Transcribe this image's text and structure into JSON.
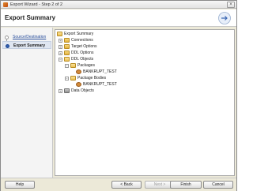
{
  "window": {
    "title": "Export Wizard - Step 2 of 2",
    "close_glyph": "×"
  },
  "header": {
    "title": "Export Summary"
  },
  "nav": {
    "items": [
      {
        "label": "Source/Destination",
        "state": "visited"
      },
      {
        "label": "Export Summary",
        "state": "current"
      }
    ]
  },
  "tree": {
    "root": "Export Summary",
    "nodes": [
      {
        "label": "Connections",
        "icon": "folder-icon",
        "expander": "+"
      },
      {
        "label": "Target Options",
        "icon": "folder-icon",
        "expander": "+"
      },
      {
        "label": "DDL Options",
        "icon": "folder-icon",
        "expander": "+"
      },
      {
        "label": "DDL Objects",
        "icon": "folder-open-icon",
        "expander": "−"
      },
      {
        "label": "Packages",
        "icon": "folder-open-icon",
        "expander": "−"
      },
      {
        "label": "BANKRUPT_TEST",
        "icon": "package-icon",
        "expander": ""
      },
      {
        "label": "Package Bodies",
        "icon": "folder-open-icon",
        "expander": "−"
      },
      {
        "label": "BANKRUPT_TEST",
        "icon": "package-body-icon",
        "expander": ""
      },
      {
        "label": "Data Objects",
        "icon": "database-icon",
        "expander": "+"
      }
    ]
  },
  "footer": {
    "help": "Help",
    "back": "< Back",
    "next": "Next >",
    "finish": "Finish",
    "cancel": "Cancel"
  }
}
